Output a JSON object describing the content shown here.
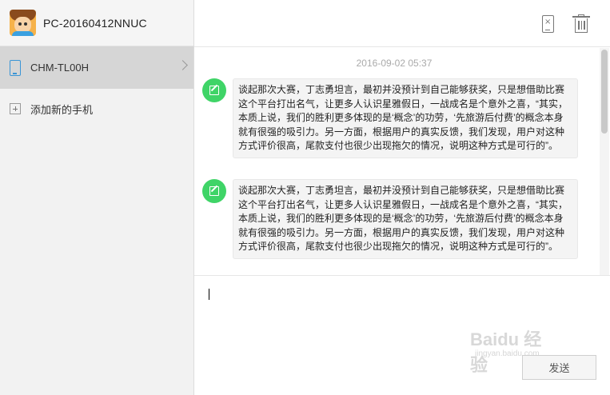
{
  "sidebar": {
    "pc_name": "PC-20160412NNUC",
    "device_label": "CHM-TL00H",
    "add_phone_label": "添加新的手机"
  },
  "chat": {
    "timestamp": "2016-09-02 05:37",
    "messages": [
      {
        "text": "谈起那次大赛，丁志勇坦言，最初并没预计到自己能够获奖，只是想借助比赛这个平台打出名气，让更多人认识星雅假日，一战成名是个意外之喜，“其实，本质上说，我们的胜利更多体现的是‘概念’的功劳，‘先旅游后付费’的概念本身就有很强的吸引力。另一方面，根据用户的真实反馈，我们发现，用户对这种方式评价很高，尾款支付也很少出现拖欠的情况，说明这种方式是可行的”。"
      },
      {
        "text": "谈起那次大赛，丁志勇坦言，最初并没预计到自己能够获奖，只是想借助比赛这个平台打出名气，让更多人认识星雅假日，一战成名是个意外之喜，“其实，本质上说，我们的胜利更多体现的是‘概念’的功劳，‘先旅游后付费’的概念本身就有很强的吸引力。另一方面，根据用户的真实反馈，我们发现，用户对这种方式评价很高，尾款支付也很少出现拖欠的情况，说明这种方式是可行的”。"
      }
    ]
  },
  "input": {
    "send_label": "发送",
    "watermark": "Baidu 经验",
    "watermark_sub": "jingyan.baidu.com"
  },
  "icons": {
    "avatar": "avatar",
    "device": "phone-icon",
    "add": "plus-icon",
    "disconnect": "phone-disconnect-icon",
    "delete": "trash-icon",
    "message": "edit-icon"
  },
  "colors": {
    "accent_green": "#3fd467",
    "phone_blue": "#3a95d6",
    "selected_bg": "#d6d6d6"
  }
}
